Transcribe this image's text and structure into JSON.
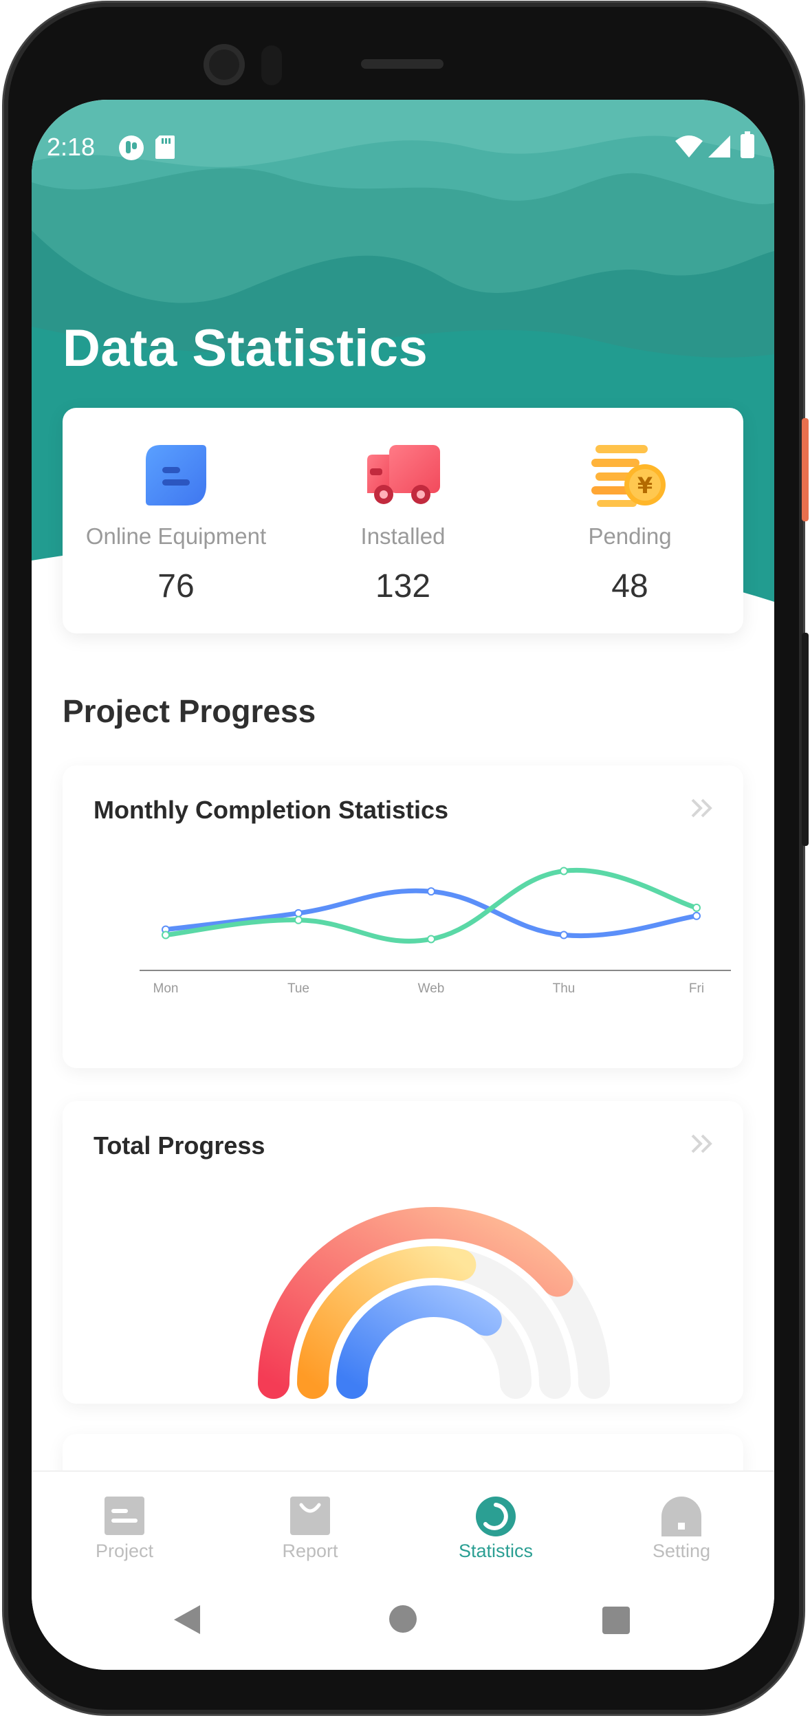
{
  "status_bar": {
    "time": "2:18"
  },
  "page_title": "Data Statistics",
  "summary": [
    {
      "label": "Online Equipment",
      "value": "76",
      "icon": "chat-bubble-icon"
    },
    {
      "label": "Installed",
      "value": "132",
      "icon": "truck-icon"
    },
    {
      "label": "Pending",
      "value": "48",
      "icon": "coins-icon"
    }
  ],
  "section_title": "Project Progress",
  "monthly_card": {
    "title": "Monthly Completion Statistics"
  },
  "total_card": {
    "title": "Total Progress"
  },
  "colors": {
    "brand_teal": "#2b9f93",
    "series_blue": "#5b8ff9",
    "series_green": "#5ad8a6",
    "arc_red": "#f45b69",
    "arc_orange": "#ffab3a",
    "arc_blue": "#4f8cf7"
  },
  "chart_data": {
    "type": "line",
    "categories": [
      "Mon",
      "Tue",
      "Web",
      "Thu",
      "Fri"
    ],
    "series": [
      {
        "values": [
          30,
          42,
          58,
          26,
          40
        ]
      },
      {
        "values": [
          26,
          37,
          23,
          73,
          46
        ]
      }
    ],
    "ylim": [
      0,
      100
    ],
    "grid": false
  },
  "progress_data": {
    "type": "radial-arc",
    "rings": [
      {
        "color": "red-to-peach",
        "fraction": 0.78
      },
      {
        "color": "orange-to-yellow",
        "fraction": 0.57
      },
      {
        "color": "blue",
        "fraction": 0.72
      }
    ]
  },
  "tabs": [
    {
      "label": "Project",
      "icon": "document-icon",
      "active": false
    },
    {
      "label": "Report",
      "icon": "report-icon",
      "active": false
    },
    {
      "label": "Statistics",
      "icon": "statistics-icon",
      "active": true
    },
    {
      "label": "Setting",
      "icon": "setting-icon",
      "active": false
    }
  ]
}
